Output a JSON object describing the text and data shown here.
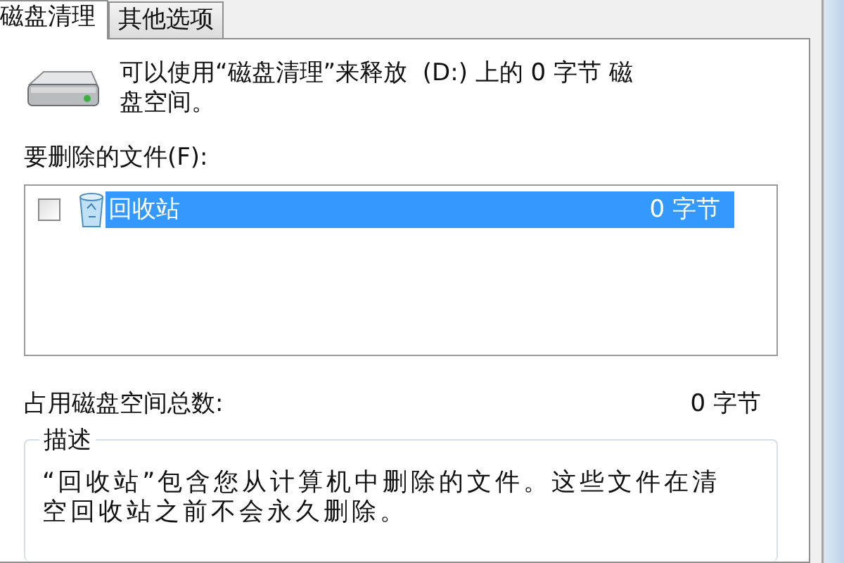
{
  "tabs": [
    {
      "label": "磁盘清理",
      "selected": true
    },
    {
      "label": "其他选项",
      "selected": false
    }
  ],
  "summary": "可以使用“磁盘清理”来释放  (D:) 上的 0 字节 磁盘空间。",
  "files_label": "要删除的文件(F):",
  "files": [
    {
      "name": "回收站",
      "size": "0 字节",
      "checked": false,
      "selected": true
    }
  ],
  "total": {
    "label": "占用磁盘空间总数:",
    "value": "0 字节"
  },
  "description": {
    "title": "描述",
    "text": "“回收站”包含您从计算机中删除的文件。这些文件在清空回收站之前不会永久删除。"
  }
}
